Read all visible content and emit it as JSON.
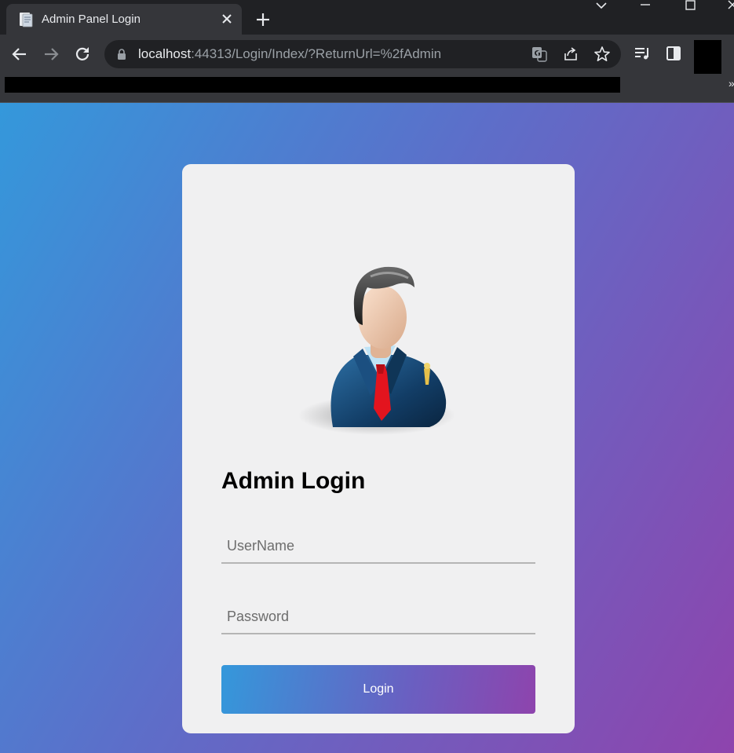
{
  "browser": {
    "tab_title": "Admin Panel Login",
    "url_host": "localhost",
    "url_rest": ":44313/Login/Index/?ReturnUrl=%2fAdmin",
    "bookmarks_overflow": "»"
  },
  "login": {
    "heading": "Admin Login",
    "username_placeholder": "UserName",
    "password_placeholder": "Password",
    "button_label": "Login"
  },
  "colors": {
    "gradient_start": "#3498db",
    "gradient_end": "#8e44ad",
    "card_background": "#f0f0f1"
  }
}
